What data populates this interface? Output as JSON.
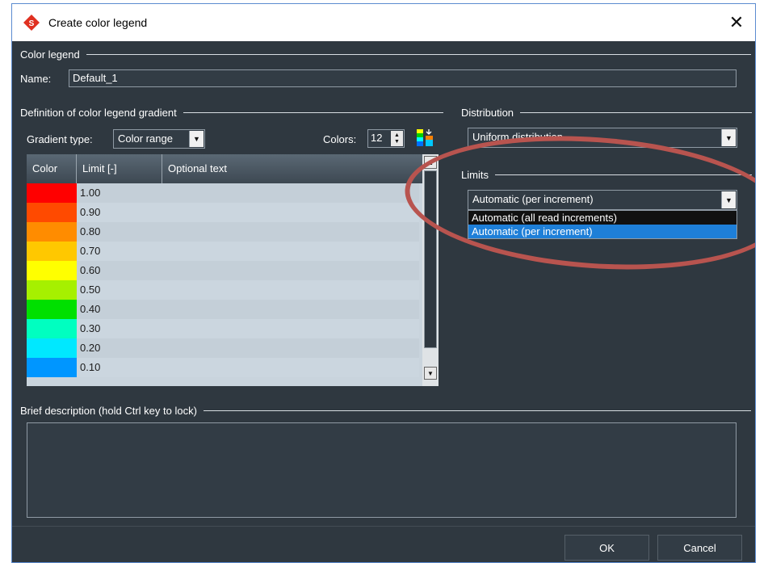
{
  "window": {
    "title": "Create color legend"
  },
  "color_legend": {
    "header": "Color legend",
    "name_label": "Name:",
    "name_value": "Default_1"
  },
  "gradient": {
    "header": "Definition of color legend gradient",
    "type_label": "Gradient type:",
    "type_value": "Color range",
    "colors_label": "Colors:",
    "colors_value": "12",
    "columns": [
      "Color",
      "Limit [-]",
      "Optional text"
    ],
    "rows": [
      {
        "color": "#ff0000",
        "limit": "1.00",
        "text": ""
      },
      {
        "color": "#ff4a00",
        "limit": "0.90",
        "text": ""
      },
      {
        "color": "#ff8c00",
        "limit": "0.80",
        "text": ""
      },
      {
        "color": "#ffc800",
        "limit": "0.70",
        "text": ""
      },
      {
        "color": "#ffff00",
        "limit": "0.60",
        "text": ""
      },
      {
        "color": "#a6f000",
        "limit": "0.50",
        "text": ""
      },
      {
        "color": "#00e000",
        "limit": "0.40",
        "text": ""
      },
      {
        "color": "#00ffc0",
        "limit": "0.30",
        "text": ""
      },
      {
        "color": "#00e8ff",
        "limit": "0.20",
        "text": ""
      },
      {
        "color": "#0096ff",
        "limit": "0.10",
        "text": ""
      }
    ]
  },
  "distribution": {
    "header": "Distribution",
    "value": "Uniform distribution"
  },
  "limits": {
    "header": "Limits",
    "value": "Automatic (per increment)",
    "options": [
      "Automatic (all read increments)",
      "Automatic (per increment)"
    ],
    "selected_index": 1
  },
  "description": {
    "header": "Brief description (hold Ctrl key to lock)",
    "value": ""
  },
  "buttons": {
    "ok": "OK",
    "cancel": "Cancel"
  },
  "colors": {
    "panel": "#2f3840",
    "highlight": "#1e7fd8",
    "annotation": "#b8544f"
  }
}
